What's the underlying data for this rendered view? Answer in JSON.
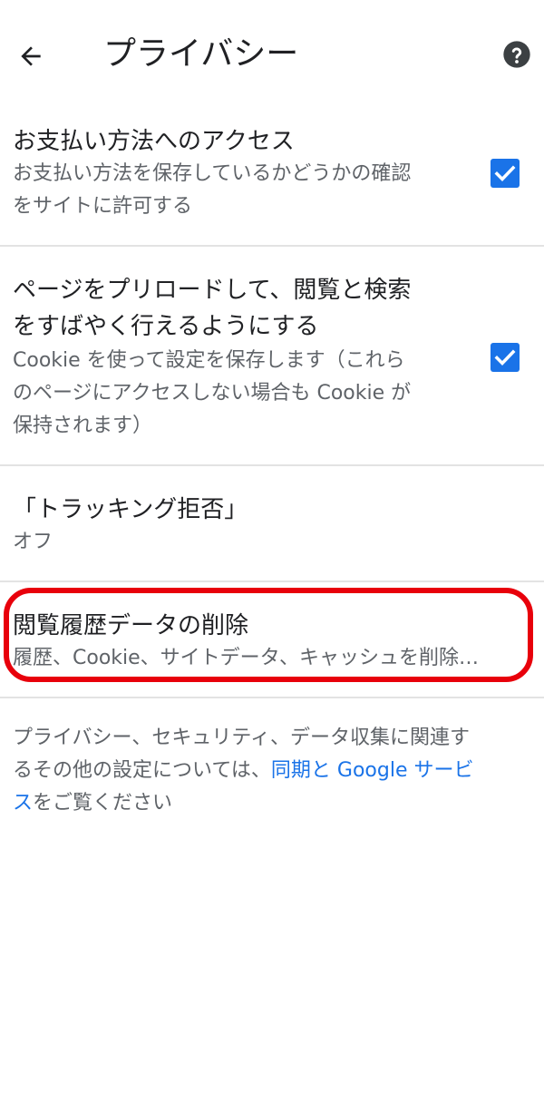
{
  "header": {
    "title": "プライバシー",
    "back_icon": "arrow-left-icon",
    "help_icon": "help-circle-icon"
  },
  "prefs": [
    {
      "title": "お支払い方法へのアクセス",
      "summary_lines": [
        "お支払い方法を保存しているかどうかの確認",
        "をサイトに許可する"
      ],
      "checked": true
    },
    {
      "title_lines": [
        "ページをプリロードして、閲覧と検索",
        "をすばやく行えるようにする"
      ],
      "summary_lines": [
        "Cookie を使って設定を保存します（これら",
        "のページにアクセスしない場合も Cookie が",
        "保持されます）"
      ],
      "checked": true
    },
    {
      "title": "「トラッキング拒否」",
      "summary": "オフ"
    },
    {
      "title": "閲覧履歴データの削除",
      "summary": "履歴、Cookie、サイトデータ、キャッシュを削除…"
    }
  ],
  "footer": {
    "line1": "プライバシー、セキュリティ、データ収集に関連す",
    "line2_prefix": "るその他の設定については、",
    "link_part1": "同期と Google サービ",
    "link_part2": "ス",
    "line3_suffix": "をご覧ください"
  },
  "colors": {
    "accent": "#1a73e8",
    "highlight": "#e8000b",
    "summary_text": "#5f6368",
    "divider": "#e3e3e3"
  }
}
